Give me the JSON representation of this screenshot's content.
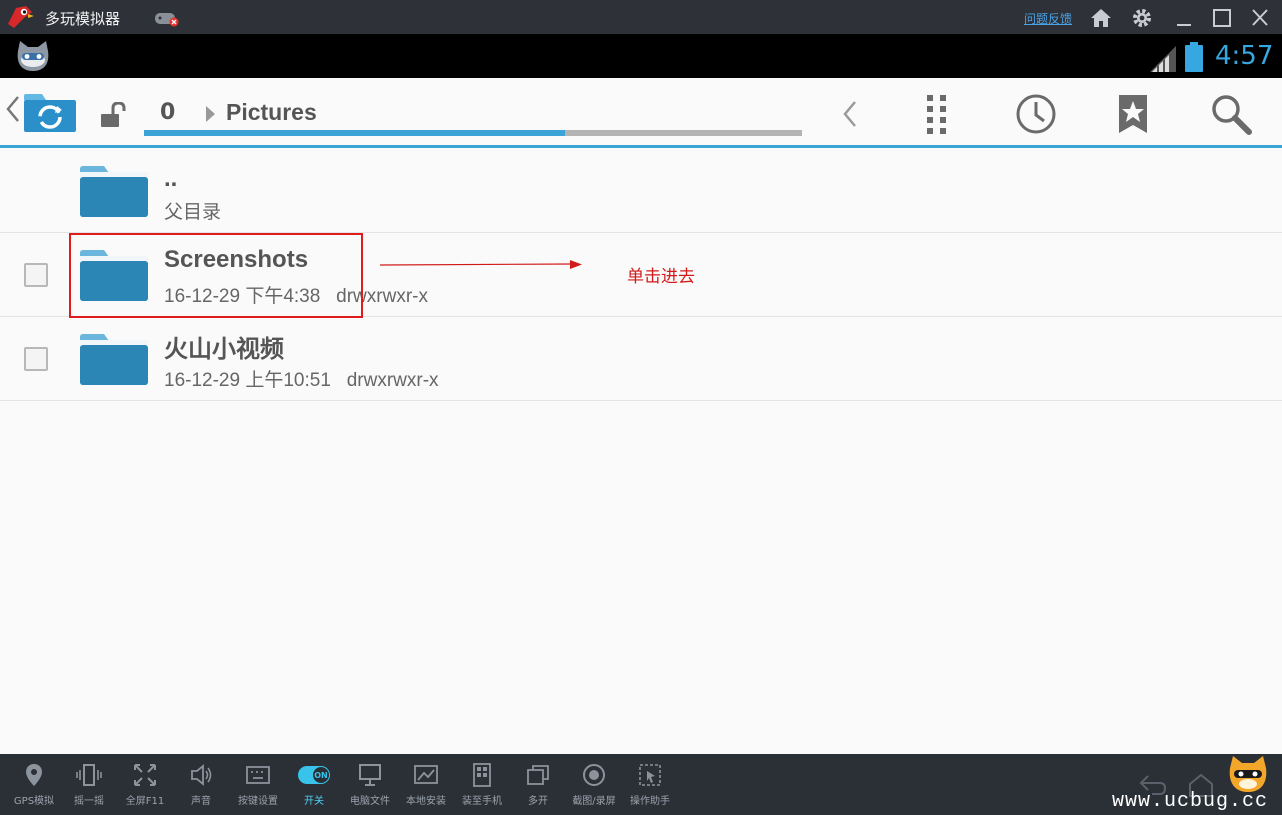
{
  "window": {
    "title": "多玩模拟器",
    "feedback_link": "问题反馈"
  },
  "status_bar": {
    "time": "4:57"
  },
  "toolbar": {
    "crumb_number": "0",
    "crumb_folder": "Pictures",
    "progress": 0.64
  },
  "files": [
    {
      "name": "..",
      "meta": "父目录",
      "checkbox": false
    },
    {
      "name": "Screenshots",
      "meta": "16-12-29 下午4:38   drwxrwxr-x",
      "checkbox": true
    },
    {
      "name": "火山小视频",
      "meta": "16-12-29 上午10:51   drwxrwxr-x",
      "checkbox": true
    }
  ],
  "annotation": {
    "text": "单击进去",
    "color": "#d21a1a"
  },
  "dock": {
    "items": [
      {
        "label": "GPS模拟",
        "icon": "location-pin-icon"
      },
      {
        "label": "摇一摇",
        "icon": "shake-phone-icon"
      },
      {
        "label": "全屏F11",
        "icon": "fullscreen-icon"
      },
      {
        "label": "声音",
        "icon": "speaker-icon"
      },
      {
        "label": "按键设置",
        "icon": "keyboard-icon"
      },
      {
        "label": "开关",
        "icon": "toggle-on-icon",
        "toggle_text": "ON"
      },
      {
        "label": "电脑文件",
        "icon": "monitor-icon"
      },
      {
        "label": "本地安装",
        "icon": "install-icon"
      },
      {
        "label": "装至手机",
        "icon": "phone-install-icon"
      },
      {
        "label": "多开",
        "icon": "multi-window-icon"
      },
      {
        "label": "截图/录屏",
        "icon": "record-icon"
      },
      {
        "label": "操作助手",
        "icon": "helper-icon"
      }
    ],
    "watermark": "www.ucbug.cc"
  },
  "colors": {
    "accent": "#3ba3d6",
    "clock": "#36a7e0",
    "highlight": "#e01b1b",
    "folder": "#2b86b6"
  }
}
